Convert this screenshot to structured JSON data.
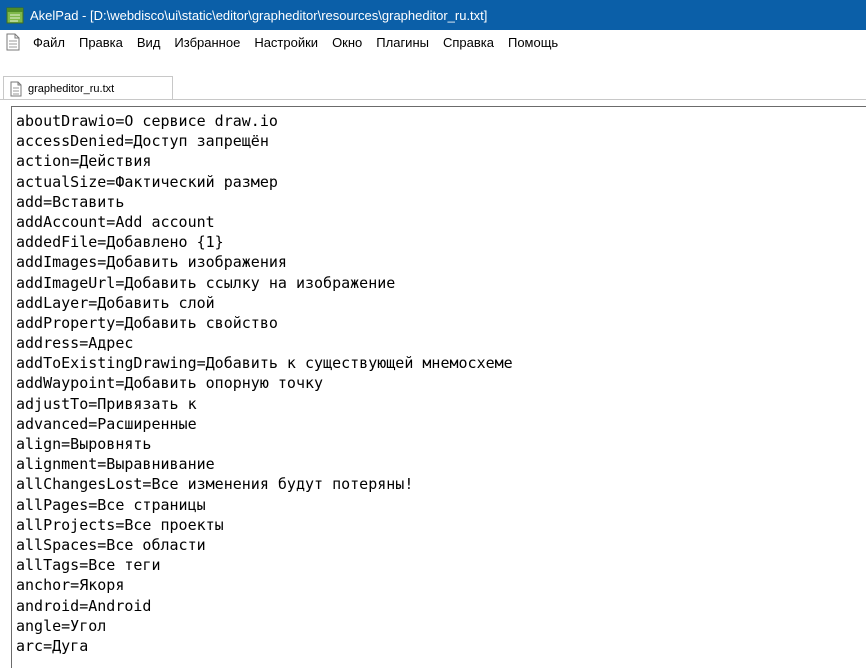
{
  "window": {
    "title": "AkelPad - [D:\\webdisco\\ui\\static\\editor\\grapheditor\\resources\\grapheditor_ru.txt]"
  },
  "icons": {
    "app": "notepad-icon",
    "document": "document-icon"
  },
  "menu": {
    "items": [
      {
        "label": "Файл"
      },
      {
        "label": "Правка"
      },
      {
        "label": "Вид"
      },
      {
        "label": "Избранное"
      },
      {
        "label": "Настройки"
      },
      {
        "label": "Окно"
      },
      {
        "label": "Плагины"
      },
      {
        "label": "Справка"
      },
      {
        "label": "Помощь"
      }
    ]
  },
  "tabs": [
    {
      "label": "grapheditor_ru.txt",
      "active": true
    }
  ],
  "editor": {
    "lines": [
      "aboutDrawio=О сервисе draw.io",
      "accessDenied=Доступ запрещён",
      "action=Действия",
      "actualSize=Фактический размер",
      "add=Вставить",
      "addAccount=Add account",
      "addedFile=Добавлено {1}",
      "addImages=Добавить изображения",
      "addImageUrl=Добавить ссылку на изображение",
      "addLayer=Добавить слой",
      "addProperty=Добавить свойство",
      "address=Адрес",
      "addToExistingDrawing=Добавить к существующей мнемосхеме",
      "addWaypoint=Добавить опорную точку",
      "adjustTo=Привязать к",
      "advanced=Расширенные",
      "align=Выровнять",
      "alignment=Выравнивание",
      "allChangesLost=Все изменения будут потеряны!",
      "allPages=Все страницы",
      "allProjects=Все проекты",
      "allSpaces=Все области",
      "allTags=Все теги",
      "anchor=Якоря",
      "android=Android",
      "angle=Угол",
      "arc=Дуга"
    ]
  },
  "colors": {
    "titlebar": "#0b5fa8",
    "titlebar_text": "#ffffff",
    "editor_text": "#000000"
  }
}
